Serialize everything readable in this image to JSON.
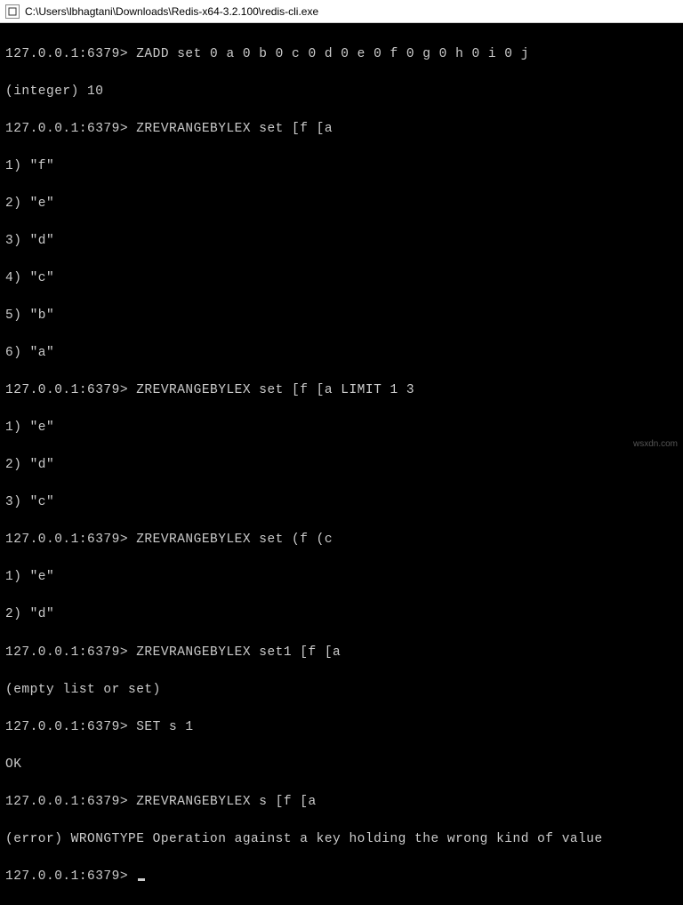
{
  "window": {
    "title": "C:\\Users\\lbhagtani\\Downloads\\Redis-x64-3.2.100\\redis-cli.exe"
  },
  "prompt": "127.0.0.1:6379>",
  "lines": {
    "l0": "127.0.0.1:6379> ZADD set 0 a 0 b 0 c 0 d 0 e 0 f 0 g 0 h 0 i 0 j",
    "l1": "(integer) 10",
    "l2": "127.0.0.1:6379> ZREVRANGEBYLEX set [f [a",
    "l3": "1) \"f\"",
    "l4": "2) \"e\"",
    "l5": "3) \"d\"",
    "l6": "4) \"c\"",
    "l7": "5) \"b\"",
    "l8": "6) \"a\"",
    "l9": "127.0.0.1:6379> ZREVRANGEBYLEX set [f [a LIMIT 1 3",
    "l10": "1) \"e\"",
    "l11": "2) \"d\"",
    "l12": "3) \"c\"",
    "l13": "127.0.0.1:6379> ZREVRANGEBYLEX set (f (c",
    "l14": "1) \"e\"",
    "l15": "2) \"d\"",
    "l16": "127.0.0.1:6379> ZREVRANGEBYLEX set1 [f [a",
    "l17": "(empty list or set)",
    "l18": "127.0.0.1:6379> SET s 1",
    "l19": "OK",
    "l20": "127.0.0.1:6379> ZREVRANGEBYLEX s [f [a",
    "l21": "(error) WRONGTYPE Operation against a key holding the wrong kind of value",
    "l22": "127.0.0.1:6379> "
  },
  "watermark": "wsxdn.com"
}
